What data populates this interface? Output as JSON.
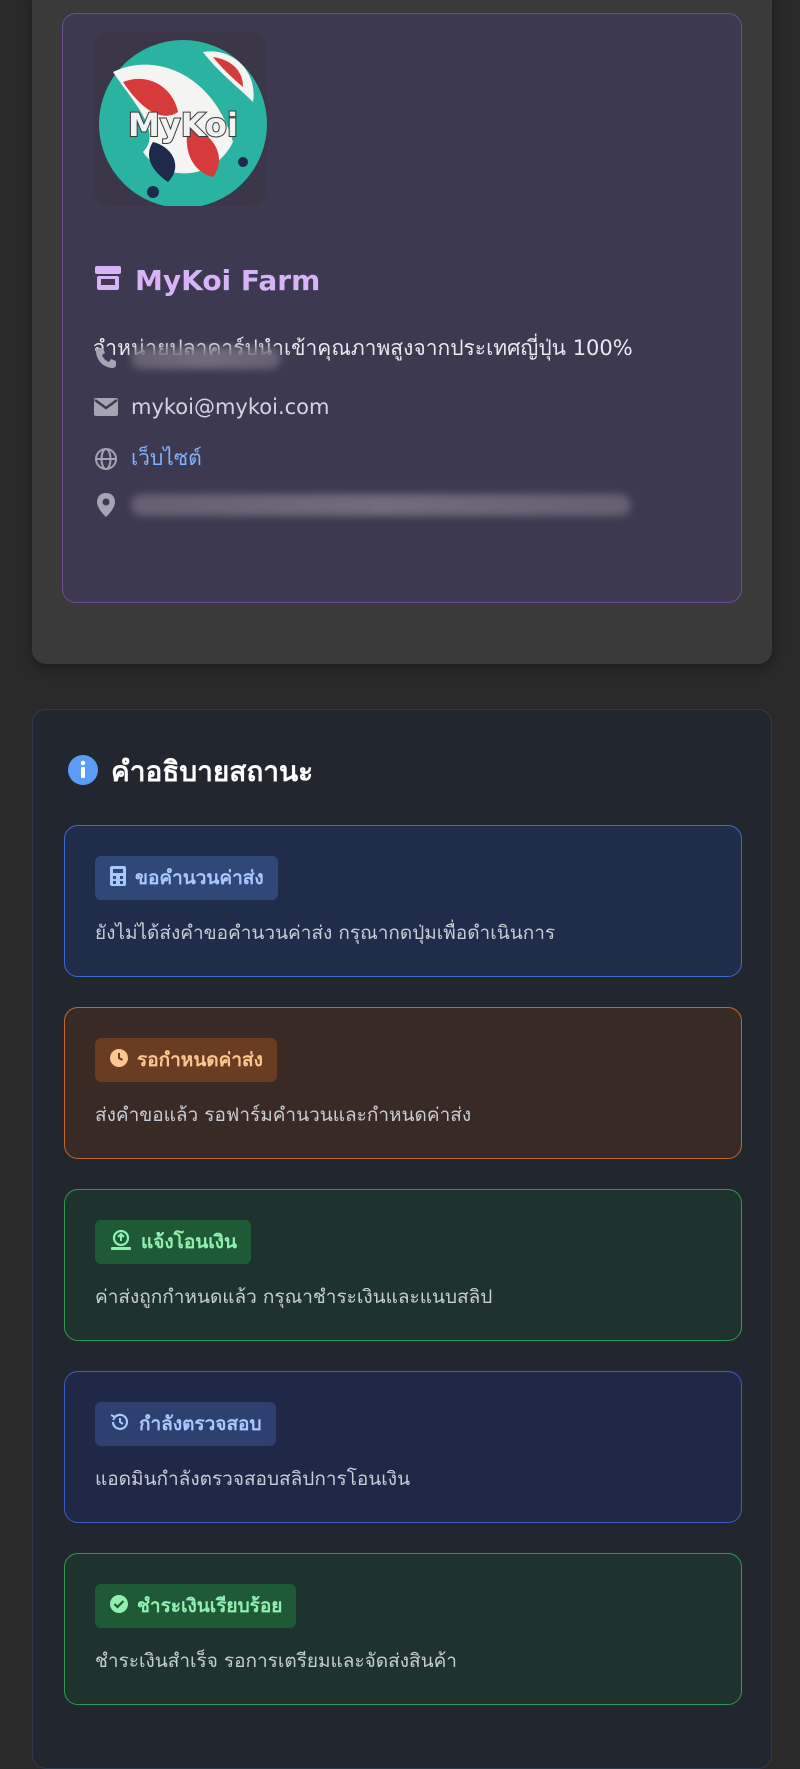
{
  "farm": {
    "logo_text": "MyKoi",
    "name": "MyKoi Farm",
    "description": "จำหน่ายปลาคาร์ปนำเข้าคุณภาพสูงจากประเทศญี่ปุ่น 100%",
    "email": "mykoi@mykoi.com",
    "website_label": "เว็บไซต์",
    "icons": [
      "store-icon",
      "phone-icon",
      "envelope-icon",
      "globe-icon",
      "location-pin-icon"
    ],
    "accent_color": "#d7b4f7"
  },
  "status_section": {
    "title": "คำอธิบายสถานะ",
    "items": [
      {
        "icon": "calculator-icon",
        "badge": "ขอคำนวนค่าส่ง",
        "description": "ยังไม่ได้ส่งคำขอคำนวนค่าส่ง กรุณากดปุ่มเพื่อดำเนินการ",
        "color": "#7fb3ff"
      },
      {
        "icon": "clock-icon",
        "badge": "รอกำหนดค่าส่ง",
        "description": "ส่งคำขอแล้ว รอฟาร์มคำนวนและกำหนดค่าส่ง",
        "color": "#fdba74"
      },
      {
        "icon": "money-upload-icon",
        "badge": "แจ้งโอนเงิน",
        "description": "ค่าส่งถูกกำหนดแล้ว กรุณาชำระเงินและแนบสลิป",
        "color": "#86efac"
      },
      {
        "icon": "history-icon",
        "badge": "กำลังตรวจสอบ",
        "description": "แอดมินกำลังตรวจสอบสลิปการโอนเงิน",
        "color": "#93c5fd"
      },
      {
        "icon": "check-circle-icon",
        "badge": "ชำระเงินเรียบร้อย",
        "description": "ชำระเงินสำเร็จ รอการเตรียมและจัดส่งสินค้า",
        "color": "#86efac"
      }
    ]
  }
}
